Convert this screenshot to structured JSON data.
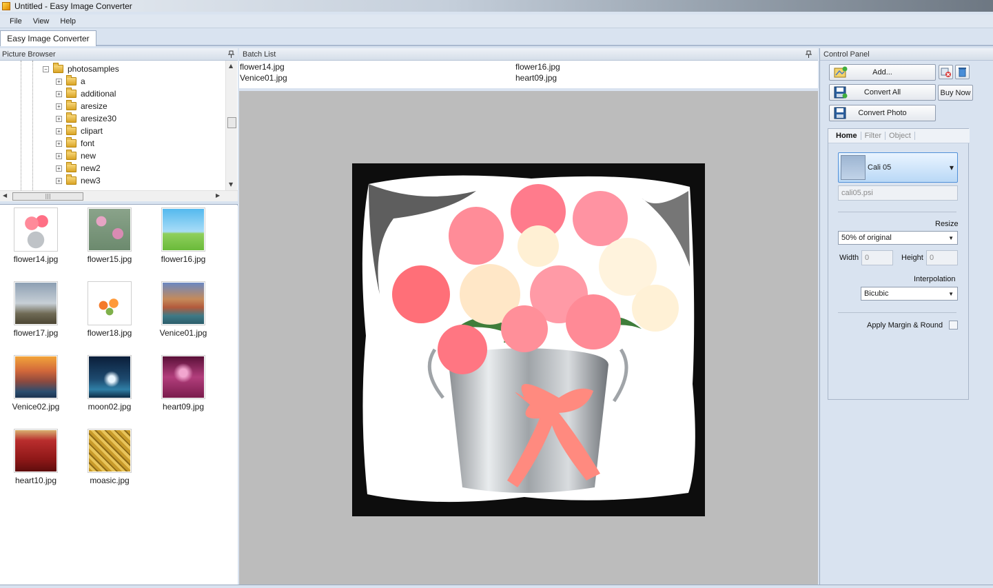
{
  "window": {
    "title": "Untitled - Easy Image Converter"
  },
  "menu": [
    "File",
    "View",
    "Help"
  ],
  "doc_tab": "Easy Image Converter",
  "picture_browser": {
    "header": "Picture Browser",
    "tree": {
      "root": "photosamples",
      "children": [
        "a",
        "additional",
        "aresize",
        "aresize30",
        "clipart",
        "font",
        "new",
        "new2",
        "new3"
      ]
    },
    "thumbnails": [
      {
        "name": "flower14.jpg"
      },
      {
        "name": "flower15.jpg"
      },
      {
        "name": "flower16.jpg"
      },
      {
        "name": "flower17.jpg"
      },
      {
        "name": "flower18.jpg"
      },
      {
        "name": "Venice01.jpg"
      },
      {
        "name": "Venice02.jpg"
      },
      {
        "name": "moon02.jpg"
      },
      {
        "name": "heart09.jpg"
      },
      {
        "name": "heart10.jpg"
      },
      {
        "name": "moasic.jpg"
      }
    ]
  },
  "batch_list": {
    "header": "Batch List",
    "items": [
      "flower14.jpg",
      "Venice01.jpg",
      "flower16.jpg",
      "heart09.jpg"
    ]
  },
  "control_panel": {
    "header": "Control Panel",
    "add_label": "Add...",
    "convert_all_label": "Convert All",
    "buy_now_label": "Buy Now",
    "convert_photo_label": "Convert Photo",
    "tabs": [
      "Home",
      "Filter",
      "Object"
    ],
    "active_tab": "Home",
    "preset_name": "Cali 05",
    "preset_file": "cali05.psi",
    "resize_label": "Resize",
    "resize_value": "50% of original",
    "width_label": "Width",
    "width_value": "0",
    "height_label": "Height",
    "height_value": "0",
    "interpolation_label": "Interpolation",
    "interpolation_value": "Bicubic",
    "margin_label": "Apply Margin & Round",
    "margin_checked": false
  }
}
